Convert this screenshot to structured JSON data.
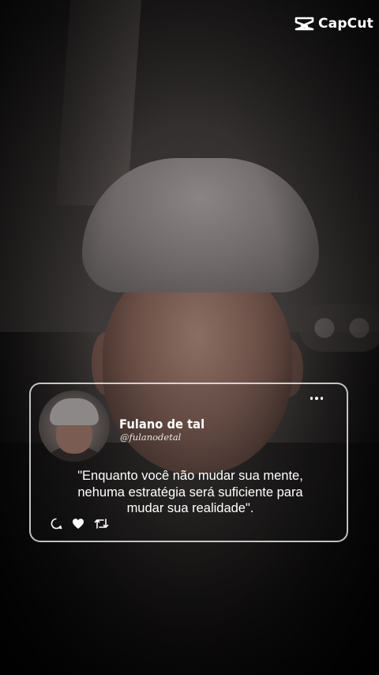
{
  "watermark": {
    "brand": "CapCut",
    "icon": "capcut-logo-icon"
  },
  "post": {
    "author_name": "Fulano de tal",
    "author_handle": "@fulanodetal",
    "quote_text": "\"Enquanto você não mudar sua mente,\nnehuma estratégia será suficiente para\nmudar sua realidade\".",
    "icons": {
      "menu": "more-dots-icon",
      "comment": "comment-icon",
      "like": "heart-icon",
      "repost": "repost-icon"
    }
  },
  "colors": {
    "text": "#ffffff",
    "card_border": "#ffffff"
  }
}
